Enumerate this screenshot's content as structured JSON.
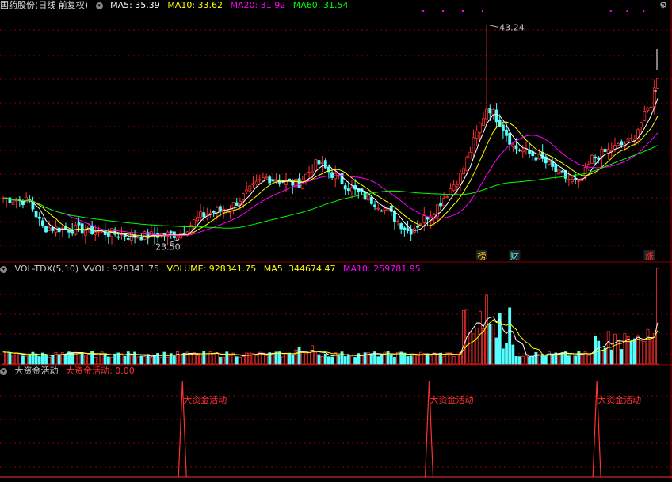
{
  "price_panel": {
    "title": "国药股份(日线 前复权)",
    "ma5": "MA5: 35.39",
    "ma10": "MA10: 33.62",
    "ma20": "MA20: 31.92",
    "ma60": "MA60: 31.54",
    "high_label": "43.24",
    "low_label": "23.50",
    "markers": [
      "榜",
      "财",
      "涨"
    ]
  },
  "volume_panel": {
    "indicator": "VOL-TDX(5,10)",
    "vvol": "VVOL: 928341.75",
    "volume": "VOLUME: 928341.75",
    "ma5": "MA5: 344674.47",
    "ma10": "MA10: 259781.95"
  },
  "signal_panel": {
    "indicator": "大资金活动",
    "value": "大资金活动: 0.00",
    "spike_label": "大资金活动"
  },
  "colors": {
    "up": "#ff3030",
    "down": "#54ffff",
    "ma5": "#ffffff",
    "ma10": "#ffff00",
    "ma20": "#ff00ff",
    "ma60": "#00ff00",
    "grid": "#8b0000"
  },
  "chart_data": {
    "type": "candlestick",
    "price_range": [
      21.5,
      44.5
    ],
    "high": 43.24,
    "low": 23.5,
    "last_close": 38.6,
    "close_path": [
      [
        0,
        27.3
      ],
      [
        0.04,
        27.0
      ],
      [
        0.06,
        24.6
      ],
      [
        0.12,
        24.4
      ],
      [
        0.2,
        23.8
      ],
      [
        0.27,
        24.0
      ],
      [
        0.3,
        25.6
      ],
      [
        0.35,
        26.6
      ],
      [
        0.4,
        29.2
      ],
      [
        0.45,
        28.6
      ],
      [
        0.48,
        30.6
      ],
      [
        0.53,
        28.2
      ],
      [
        0.58,
        26.5
      ],
      [
        0.62,
        24.2
      ],
      [
        0.66,
        26.3
      ],
      [
        0.7,
        29.5
      ],
      [
        0.725,
        33.5
      ],
      [
        0.74,
        35.8
      ],
      [
        0.76,
        34.2
      ],
      [
        0.78,
        32.0
      ],
      [
        0.82,
        31.0
      ],
      [
        0.85,
        29.5
      ],
      [
        0.88,
        28.5
      ],
      [
        0.9,
        31.0
      ],
      [
        0.93,
        31.8
      ],
      [
        0.96,
        32.6
      ],
      [
        0.99,
        36.0
      ],
      [
        1.0,
        38.6
      ]
    ],
    "signal_spikes": [
      0.275,
      0.65,
      0.905
    ],
    "signal_value": 0.0,
    "last_volume": 928341.75
  }
}
